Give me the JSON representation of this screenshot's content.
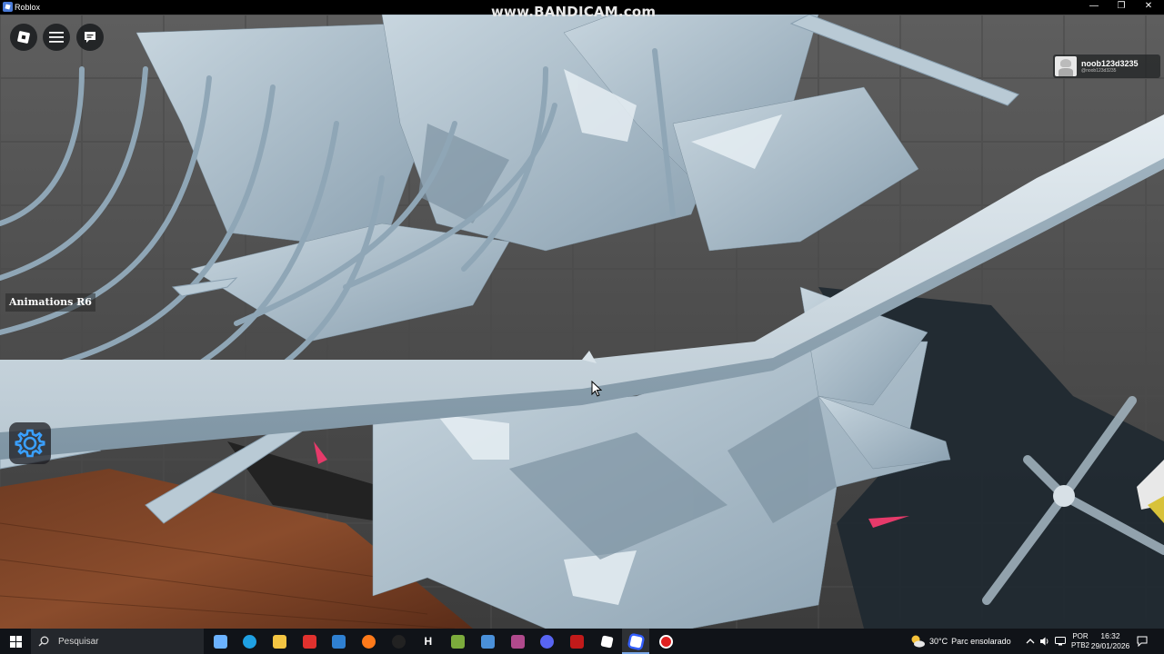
{
  "window": {
    "title": "Roblox",
    "minimize_glyph": "—",
    "maximize_glyph": "❐",
    "close_glyph": "✕"
  },
  "recording": {
    "watermark": "www.BANDICAM.com"
  },
  "hud": {
    "roblox_button_icon": "roblox-logo-icon",
    "menu_button_icon": "hamburger-icon",
    "chat_button_icon": "chat-icon",
    "player": {
      "name": "noob123d3235",
      "subtitle": "@noob123d3235"
    },
    "animations_label": "Animations R6",
    "settings_icon": "gear-icon"
  },
  "taskbar": {
    "search_placeholder": "Pesquisar",
    "apps": [
      {
        "icon": "copilot-icon",
        "color": "#6bb2ff"
      },
      {
        "icon": "edge-icon",
        "color": "#1fa0e3"
      },
      {
        "icon": "file-explorer-icon",
        "color": "#f4c542"
      },
      {
        "icon": "red-app-icon",
        "color": "#e0312e"
      },
      {
        "icon": "store-icon",
        "color": "#2f80d1"
      },
      {
        "icon": "firefox-icon",
        "color": "#ff7a1a"
      },
      {
        "icon": "media-app-icon",
        "color": "#222"
      },
      {
        "icon": "h-app-icon",
        "color": "#101318",
        "letter": "H"
      },
      {
        "icon": "minecraft-icon",
        "color": "#7cab3c"
      },
      {
        "icon": "mail-app-icon",
        "color": "#4a90d9"
      },
      {
        "icon": "winrar-icon",
        "color": "#b04a8c"
      },
      {
        "icon": "discord-icon",
        "color": "#5865f2"
      },
      {
        "icon": "red-square-app-icon",
        "color": "#c21a1a"
      },
      {
        "icon": "roblox-studio-icon",
        "color": "#101318"
      },
      {
        "icon": "roblox-icon",
        "color": "#335fff"
      },
      {
        "icon": "bandicam-icon",
        "color": "#e02020"
      }
    ],
    "weather": {
      "temperature": "30°C",
      "condition": "Parc ensolarado"
    },
    "language": {
      "line1": "POR",
      "line2": "PTB2"
    },
    "clock": {
      "time": "16:32",
      "date": "29/01/2026"
    }
  }
}
